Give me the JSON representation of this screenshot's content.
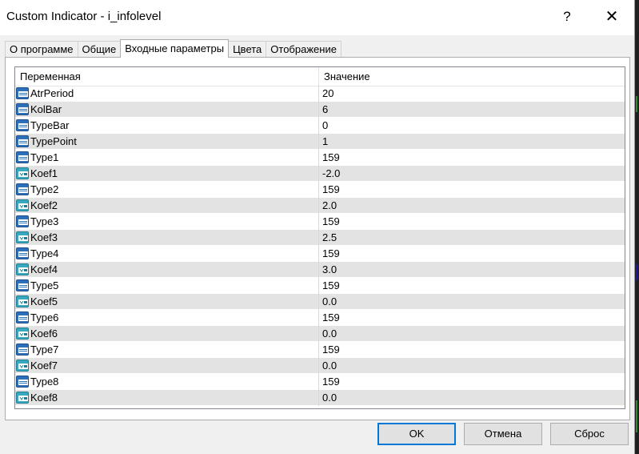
{
  "window": {
    "title": "Custom Indicator - i_infolevel",
    "help_glyph": "?",
    "close_glyph": "✕"
  },
  "tabs": [
    {
      "label": "О программе"
    },
    {
      "label": "Общие"
    },
    {
      "label": "Входные параметры"
    },
    {
      "label": "Цвета"
    },
    {
      "label": "Отображение"
    }
  ],
  "active_tab": "Входные параметры",
  "grid": {
    "columns": {
      "variable": "Переменная",
      "value": "Значение"
    },
    "rows": [
      {
        "name": "AtrPeriod",
        "value": "20",
        "type": "int-icon"
      },
      {
        "name": "KolBar",
        "value": "6",
        "type": "int-icon"
      },
      {
        "name": "TypeBar",
        "value": "0",
        "type": "int-icon"
      },
      {
        "name": "TypePoint",
        "value": "1",
        "type": "int-icon"
      },
      {
        "name": "Type1",
        "value": "159",
        "type": "int-icon"
      },
      {
        "name": "Koef1",
        "value": "-2.0",
        "type": "double-icon"
      },
      {
        "name": "Type2",
        "value": "159",
        "type": "int-icon"
      },
      {
        "name": "Koef2",
        "value": "2.0",
        "type": "double-icon"
      },
      {
        "name": "Type3",
        "value": "159",
        "type": "int-icon"
      },
      {
        "name": "Koef3",
        "value": "2.5",
        "type": "double-icon"
      },
      {
        "name": "Type4",
        "value": "159",
        "type": "int-icon"
      },
      {
        "name": "Koef4",
        "value": "3.0",
        "type": "double-icon"
      },
      {
        "name": "Type5",
        "value": "159",
        "type": "int-icon"
      },
      {
        "name": "Koef5",
        "value": "0.0",
        "type": "double-icon"
      },
      {
        "name": "Type6",
        "value": "159",
        "type": "int-icon"
      },
      {
        "name": "Koef6",
        "value": "0.0",
        "type": "double-icon"
      },
      {
        "name": "Type7",
        "value": "159",
        "type": "int-icon"
      },
      {
        "name": "Koef7",
        "value": "0.0",
        "type": "double-icon"
      },
      {
        "name": "Type8",
        "value": "159",
        "type": "int-icon"
      },
      {
        "name": "Koef8",
        "value": "0.0",
        "type": "double-icon"
      }
    ]
  },
  "buttons": {
    "ok": "OK",
    "cancel": "Отмена",
    "reset": "Сброс"
  },
  "colors": {
    "int_icon": "#2d6fb8",
    "double_icon": "#37a8c0",
    "alt_row": "#e3e3e3",
    "default_button_border": "#0078d7"
  }
}
